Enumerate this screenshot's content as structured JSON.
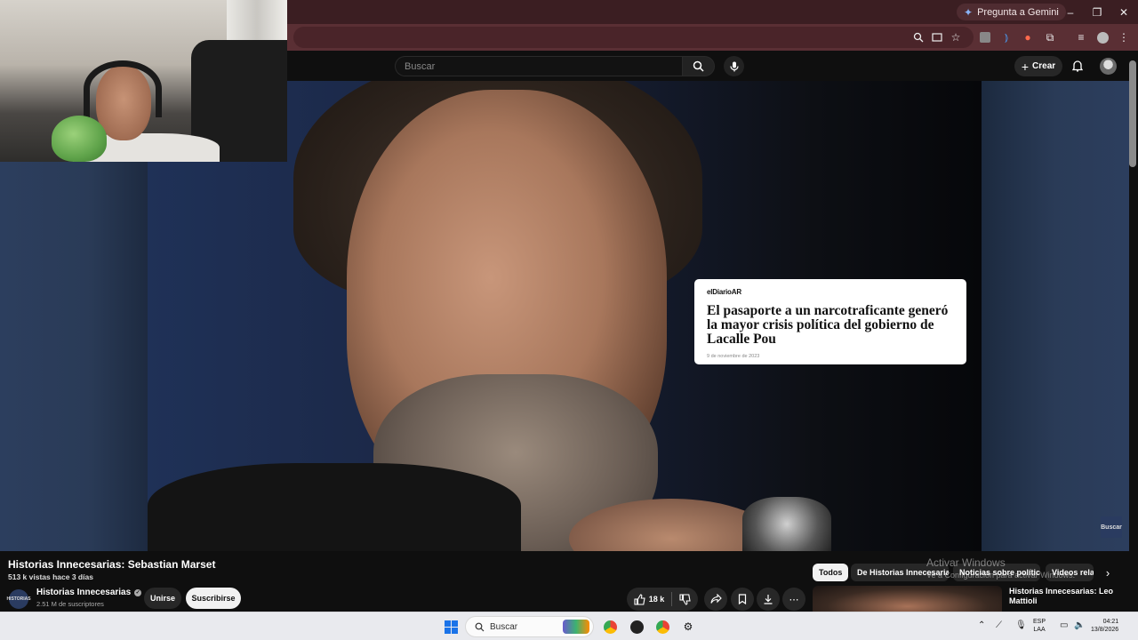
{
  "browser": {
    "gemini_label": "Pregunta a Gemini",
    "window_controls": {
      "minimize": "–",
      "restore": "❐",
      "close": "✕"
    }
  },
  "youtube_header": {
    "search_placeholder": "Buscar",
    "create_label": "Crear"
  },
  "video": {
    "news_card": {
      "source_logo": "elDiarioAR",
      "headline": "El pasaporte a un narcotraficante generó la mayor crisis política del gobierno de Lacalle Pou",
      "date": "9 de noviembre de 2023"
    },
    "watermark": "Buscar"
  },
  "info": {
    "title": "Historias Innecesarias: Sebastian Marset",
    "meta": "513 k vistas  hace 3 días",
    "channel_name": "Historias Innecesarias",
    "channel_avatar_text": "HISTORIAS",
    "subscribers": "2.51 M de suscriptores",
    "join_label": "Unirse",
    "subscribe_label": "Suscribirse",
    "likes": "18 k"
  },
  "chips": [
    "Todos",
    "De Historias Innecesarias",
    "Noticias sobre política",
    "Videos relacionados"
  ],
  "windows_activation": {
    "title": "Activar Windows",
    "subtitle": "Ve a Configuración para activar Windows."
  },
  "recommended": {
    "title": "Historias Innecesarias: Leo Mattioli"
  },
  "taskbar": {
    "search_label": "Buscar",
    "lang_top": "ESP",
    "lang_bottom": "LAA",
    "time": "04:21",
    "date": "13/8/2026"
  },
  "colors": {
    "chrome_title": "#3b1e22",
    "chrome_toolbar": "#5a2f34",
    "youtube_bg": "#0f0f0f",
    "chip_active": "#f1f1f1"
  }
}
